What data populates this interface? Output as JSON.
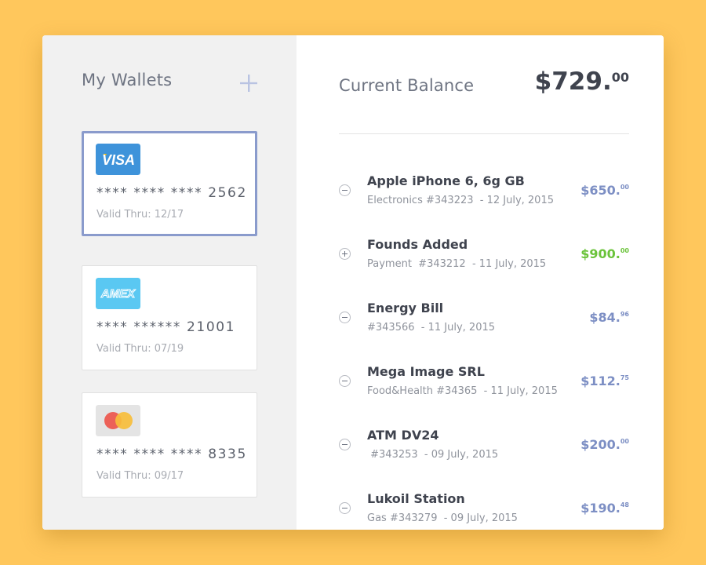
{
  "sidebar": {
    "title": "My Wallets",
    "add_icon": "plus-icon",
    "cards": [
      {
        "brand": "VISA",
        "icon": "visa-logo",
        "number": "**** **** **** 2562",
        "valid": "Valid Thru: 12/17",
        "selected": true
      },
      {
        "brand": "AMEX",
        "icon": "amex-logo",
        "number": "**** ****** 21001",
        "valid": "Valid Thru: 07/19",
        "selected": false
      },
      {
        "brand": "",
        "icon": "mastercard-logo",
        "number": "**** **** **** 8335",
        "valid": "Valid Thru: 09/17",
        "selected": false
      }
    ]
  },
  "main": {
    "balance_label": "Current Balance",
    "balance_whole": "$729.",
    "balance_cents": "00",
    "transactions": [
      {
        "title": "Apple iPhone 6, 6g GB",
        "subtitle": "Electronics #343223  - 12 July, 2015",
        "amount_whole": "$650.",
        "amount_cents": "00",
        "type": "debit"
      },
      {
        "title": "Founds Added",
        "subtitle": "Payment  #343212  - 11 July, 2015",
        "amount_whole": "$900.",
        "amount_cents": "00",
        "type": "credit"
      },
      {
        "title": "Energy Bill",
        "subtitle": "#343566  - 11 July, 2015",
        "amount_whole": "$84.",
        "amount_cents": "96",
        "type": "debit"
      },
      {
        "title": "Mega Image SRL",
        "subtitle": "Food&Health #34365  - 11 July, 2015",
        "amount_whole": "$112.",
        "amount_cents": "75",
        "type": "debit"
      },
      {
        "title": "ATM DV24",
        "subtitle": " #343253  - 09 July, 2015",
        "amount_whole": "$200.",
        "amount_cents": "00",
        "type": "debit"
      },
      {
        "title": "Lukoil Station",
        "subtitle": "Gas #343279  - 09 July, 2015",
        "amount_whole": "$190.",
        "amount_cents": "48",
        "type": "debit"
      }
    ]
  },
  "colors": {
    "background": "#FFC75C",
    "sidebar": "#F1F1F1",
    "debit_amount": "#7D8FC4",
    "credit_amount": "#6BC33B",
    "selected_border": "#8A9BCC",
    "visa": "#3E93DA",
    "amex": "#5AC8F2"
  }
}
